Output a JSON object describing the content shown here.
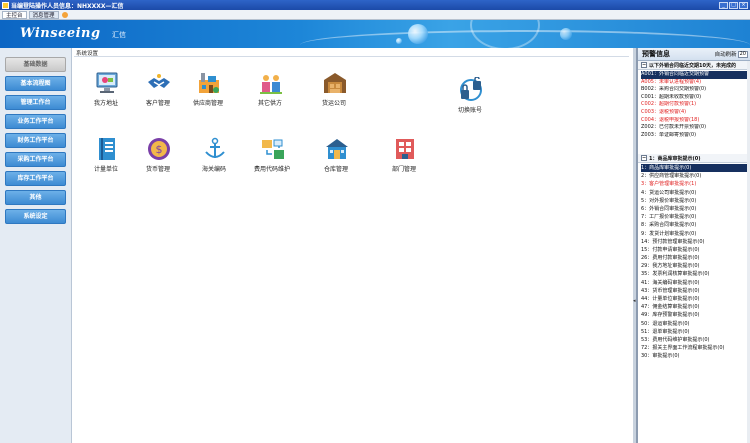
{
  "window": {
    "title": "当编登陆操作人员信息：NHXXXX—汇信"
  },
  "menubar": {
    "tabs": [
      {
        "label": "主控台"
      },
      {
        "label": "消息管理"
      }
    ]
  },
  "banner": {
    "logo": "Winseeing",
    "logo_sub": "汇信"
  },
  "nav": {
    "items": [
      {
        "label": "基础数据",
        "active": true
      },
      {
        "label": "基本流程图"
      },
      {
        "label": "管理工作台"
      },
      {
        "label": "业务工作平台"
      },
      {
        "label": "财务工作平台"
      },
      {
        "label": "采购工作平台"
      },
      {
        "label": "库存工作平台"
      },
      {
        "label": "其他"
      },
      {
        "label": "系统设定"
      }
    ]
  },
  "main": {
    "breadcrumb": "系统设置",
    "tiles": [
      {
        "label": "我方地址",
        "icon": "computer-icon"
      },
      {
        "label": "客户管理",
        "icon": "handshake-icon"
      },
      {
        "label": "供应商管理",
        "icon": "factory-icon"
      },
      {
        "label": "其它供方",
        "icon": "people-icon"
      },
      {
        "label": "货运公司",
        "icon": "warehouse-icon"
      },
      {
        "label": "切换账号",
        "icon": "switch-account-icon"
      },
      {
        "label": "计量单位",
        "icon": "book-icon"
      },
      {
        "label": "货币管理",
        "icon": "currency-icon"
      },
      {
        "label": "海关编码",
        "icon": "anchor-icon"
      },
      {
        "label": "费用代码维护",
        "icon": "fee-code-icon"
      },
      {
        "label": "仓库管理",
        "icon": "building-icon"
      },
      {
        "label": "部门管理",
        "icon": "department-icon"
      }
    ]
  },
  "warning_panel": {
    "title": "预警信息",
    "refresh_label": "自动刷新",
    "refresh_value": "20",
    "section1": {
      "title": "以下外销合同临近交期10天，未完成的",
      "rows": [
        {
          "text": "A001：外销合同临近交期预警",
          "style": "sel"
        },
        {
          "text": "A005：未审认进程预警(4)",
          "style": "red"
        },
        {
          "text": "B002：采购合同交期预警(0)",
          "style": "blk"
        },
        {
          "text": "C001：超期未收款预警(0)",
          "style": "blk"
        },
        {
          "text": "C002：超期付款预警(1)",
          "style": "red"
        },
        {
          "text": "C003：退税预警(4)",
          "style": "red"
        },
        {
          "text": "C004：退税申报预警(18)",
          "style": "red"
        },
        {
          "text": "Z002：已付款未开票预警(0)",
          "style": "blk"
        },
        {
          "text": "Z003：单证邮寄预警(0)",
          "style": "blk"
        }
      ]
    },
    "section2": {
      "title": "1：商品库审批提示(0)",
      "rows": [
        {
          "text": "1：商品库审批提示(0)",
          "style": "sel"
        },
        {
          "text": "2：供应商管理审批提示(0)",
          "style": ""
        },
        {
          "text": "3：客户管理审批提示(1)",
          "style": "red"
        },
        {
          "text": "4：货运公司审批提示(0)",
          "style": ""
        },
        {
          "text": "5：对外报价审批提示(0)",
          "style": ""
        },
        {
          "text": "6：外销合同审批提示(0)",
          "style": ""
        },
        {
          "text": "7：工厂报价审批提示(0)",
          "style": ""
        },
        {
          "text": "8：采购合同审批提示(0)",
          "style": ""
        },
        {
          "text": "9：发货计划审批提示(0)",
          "style": ""
        },
        {
          "text": "14：预付款管理审批提示(0)",
          "style": ""
        },
        {
          "text": "15：付款申请审批提示(0)",
          "style": ""
        },
        {
          "text": "26：费用付款审批提示(0)",
          "style": ""
        },
        {
          "text": "29：我方地址审批提示(0)",
          "style": ""
        },
        {
          "text": "35：发票利润核算审批提示(0)",
          "style": ""
        },
        {
          "text": "41：海关编码审批提示(0)",
          "style": ""
        },
        {
          "text": "43：货币管理审批提示(0)",
          "style": ""
        },
        {
          "text": "44：计量单位审批提示(0)",
          "style": ""
        },
        {
          "text": "47：佣金结算审批提示(0)",
          "style": ""
        },
        {
          "text": "49：库存预警审批提示(0)",
          "style": ""
        },
        {
          "text": "50：退运审批提示(0)",
          "style": ""
        },
        {
          "text": "51：退单审批提示(0)",
          "style": ""
        },
        {
          "text": "53：费用代码维护审批提示(0)",
          "style": ""
        },
        {
          "text": "72：报关主界面工作流程审批提示(0)",
          "style": ""
        },
        {
          "text": "30：审批提示(0)",
          "style": ""
        }
      ]
    }
  },
  "colors": {
    "accent": "#1d86d8",
    "nav_button": "#3d8bd3",
    "alert_red": "#e02020",
    "selection": "#16305f"
  }
}
